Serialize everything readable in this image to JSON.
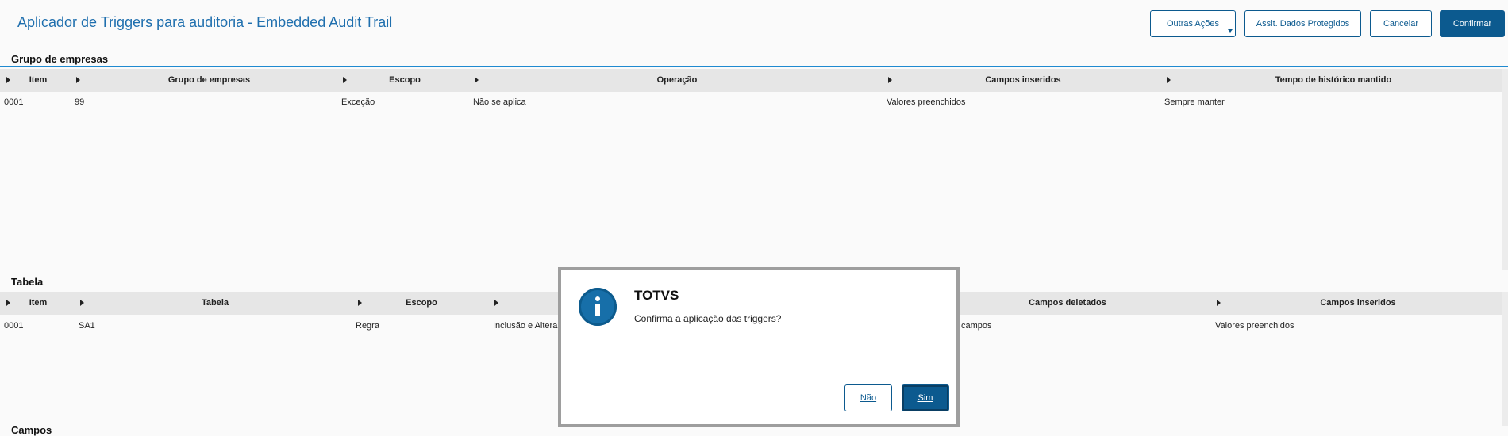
{
  "page": {
    "title": "Aplicador de Triggers para auditoria - Embedded Audit Trail"
  },
  "toolbar": {
    "other_actions": "Outras Ações",
    "protected_data": "Assit. Dados Protegidos",
    "cancel": "Cancelar",
    "confirm": "Confirmar"
  },
  "grupo": {
    "title": "Grupo de empresas",
    "columns": [
      "Item",
      "Grupo de empresas",
      "Escopo",
      "Operação",
      "Campos inseridos",
      "Tempo de histórico mantido"
    ],
    "rows": [
      [
        "0001",
        "99",
        "Exceção",
        "Não se aplica",
        "Valores preenchidos",
        "Sempre manter"
      ]
    ]
  },
  "tabela": {
    "title": "Tabela",
    "columns": [
      "Item",
      "Tabela",
      "Escopo",
      "Campos deletados",
      "Campos inseridos"
    ],
    "rows": [
      [
        "0001",
        "SA1",
        "Regra",
        "Inclusão e Altera",
        "campos",
        "Valores preenchidos"
      ]
    ]
  },
  "campos": {
    "title": "Campos"
  },
  "dialog": {
    "title": "TOTVS",
    "message": "Confirma a aplicação das triggers?",
    "no_label": "Não",
    "yes_label": "Sim",
    "icon": "info-icon"
  },
  "colors": {
    "accent": "#0c5a8f",
    "title": "#1f6fae",
    "line": "#1f8ad0"
  }
}
